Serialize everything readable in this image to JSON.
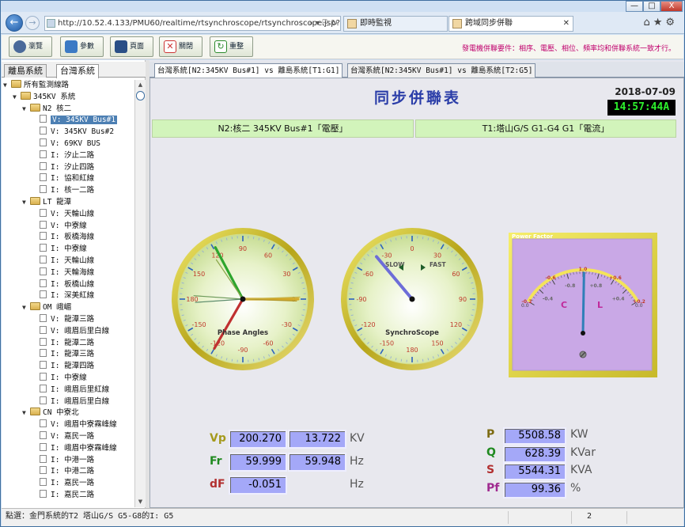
{
  "browser": {
    "url": "http://10.52.4.133/PMU60/realtime/rtsynchroscope/rtsynchroscope.jsp?fun=null",
    "addr_icons": "⌕ ▾ ⎘ ↻",
    "tabs": [
      {
        "label": "即時監視"
      },
      {
        "label": "跨域同步併聯"
      }
    ],
    "window_buttons": {
      "minimize": "—",
      "maximize": "□",
      "close": "X"
    },
    "right_icons": "⌂★⚙"
  },
  "toolbar": {
    "buttons": [
      {
        "label": "瀏覽"
      },
      {
        "label": "參數"
      },
      {
        "label": "頁面"
      },
      {
        "label": "關閉"
      },
      {
        "label": "重整"
      }
    ],
    "tip": "發電機併聯要件：相序、電壓、相位、頻率均和併聯系統一致才行。"
  },
  "sidebar": {
    "tabs": [
      "離島系統",
      "台灣系統"
    ],
    "tree": [
      {
        "label": "所有監測線路",
        "level": 0,
        "type": "folder"
      },
      {
        "label": "345KV 系統",
        "level": 1,
        "type": "folder"
      },
      {
        "label": "N2 核二",
        "level": 2,
        "type": "folder"
      },
      {
        "label": "V: 345KV Bus#1",
        "level": 3,
        "type": "doc",
        "selected": true
      },
      {
        "label": "V: 345KV Bus#2",
        "level": 3,
        "type": "doc"
      },
      {
        "label": "V: 69KV BUS",
        "level": 3,
        "type": "doc"
      },
      {
        "label": "I: 汐止二路",
        "level": 3,
        "type": "doc"
      },
      {
        "label": "I: 汐止四路",
        "level": 3,
        "type": "doc"
      },
      {
        "label": "I: 協和紅線",
        "level": 3,
        "type": "doc"
      },
      {
        "label": "I: 核一二路",
        "level": 3,
        "type": "doc"
      },
      {
        "label": "LT 龍潭",
        "level": 2,
        "type": "folder"
      },
      {
        "label": "V: 天輪山線",
        "level": 3,
        "type": "doc"
      },
      {
        "label": "V: 中寮線",
        "level": 3,
        "type": "doc"
      },
      {
        "label": "I: 板橋海線",
        "level": 3,
        "type": "doc"
      },
      {
        "label": "I: 中寮線",
        "level": 3,
        "type": "doc"
      },
      {
        "label": "I: 天輪山線",
        "level": 3,
        "type": "doc"
      },
      {
        "label": "I: 天輪海線",
        "level": 3,
        "type": "doc"
      },
      {
        "label": "I: 板橋山線",
        "level": 3,
        "type": "doc"
      },
      {
        "label": "I: 深美紅線",
        "level": 3,
        "type": "doc"
      },
      {
        "label": "OM 峨嵋",
        "level": 2,
        "type": "folder"
      },
      {
        "label": "V: 龍潭三路",
        "level": 3,
        "type": "doc"
      },
      {
        "label": "V: 峨眉后里白線",
        "level": 3,
        "type": "doc"
      },
      {
        "label": "I: 龍潭二路",
        "level": 3,
        "type": "doc"
      },
      {
        "label": "I: 龍潭三路",
        "level": 3,
        "type": "doc"
      },
      {
        "label": "I: 龍潭四路",
        "level": 3,
        "type": "doc"
      },
      {
        "label": "I: 中寮線",
        "level": 3,
        "type": "doc"
      },
      {
        "label": "I: 峨眉后里紅線",
        "level": 3,
        "type": "doc"
      },
      {
        "label": "I: 峨眉后里白線",
        "level": 3,
        "type": "doc"
      },
      {
        "label": "CN 中寮北",
        "level": 2,
        "type": "folder"
      },
      {
        "label": "V: 峨眉中寮霧峰線",
        "level": 3,
        "type": "doc"
      },
      {
        "label": "V: 嘉民一路",
        "level": 3,
        "type": "doc"
      },
      {
        "label": "I: 峨眉中寮霧峰線",
        "level": 3,
        "type": "doc"
      },
      {
        "label": "I: 中港一路",
        "level": 3,
        "type": "doc"
      },
      {
        "label": "I: 中港二路",
        "level": 3,
        "type": "doc"
      },
      {
        "label": "I: 嘉民一路",
        "level": 3,
        "type": "doc"
      },
      {
        "label": "I: 嘉民二路",
        "level": 3,
        "type": "doc"
      }
    ]
  },
  "main": {
    "tabs": [
      "台灣系統[N2:345KV Bus#1] vs 離島系統[T1:G1]",
      "台灣系統[N2:345KV Bus#1] vs 離島系統[T2:G5]"
    ],
    "title": "同步併聯表",
    "date": "2018-07-09",
    "time": "14:57:44A",
    "left_channel": "N2:核二 345KV Bus#1「電壓」",
    "right_channel": "T1:塔山G/S G1-G4 G1「電流」"
  },
  "gauges": {
    "phase": {
      "label": "Phase Angles",
      "ticks": [
        "0",
        "30",
        "60",
        "90",
        "120",
        "150",
        "180",
        "-150",
        "-120",
        "-90",
        "-60",
        "-30"
      ],
      "needles_deg": [
        0,
        -2,
        2,
        118,
        124,
        240,
        176,
        184
      ]
    },
    "synchro": {
      "label": "SynchroScope",
      "slow": "SLOW",
      "fast": "FAST",
      "ticks": [
        "0",
        "-30",
        "-60",
        "-90",
        "-120",
        "-150",
        "180",
        "150",
        "120",
        "90",
        "60",
        "30"
      ],
      "needle_deg": -40
    },
    "pf": {
      "title": "Power Factor",
      "scale": [
        "-0.2",
        "-0.4",
        "-0.6",
        "-0.8",
        "1.0",
        "+0.8",
        "+0.6",
        "+0.4",
        "+0.2"
      ],
      "ends": [
        "0.0",
        "0.0"
      ],
      "c": "C",
      "l": "L",
      "value": 0.993
    }
  },
  "readings": {
    "left": [
      {
        "label": "Vp",
        "v1": "200.270",
        "v2": "13.722",
        "unit": "KV"
      },
      {
        "label": "Fr",
        "v1": "59.999",
        "v2": "59.948",
        "unit": "Hz"
      },
      {
        "label": "dF",
        "v1": "-0.051",
        "v2": "",
        "unit": "Hz"
      }
    ],
    "right": [
      {
        "label": "P",
        "value": "5508.58",
        "unit": "KW"
      },
      {
        "label": "Q",
        "value": "628.39",
        "unit": "KVar"
      },
      {
        "label": "S",
        "value": "5544.31",
        "unit": "KVA"
      },
      {
        "label": "Pf",
        "value": "99.36",
        "unit": "%"
      }
    ]
  },
  "status": {
    "text": "點選：金門系統的T2 塔山G/S G5-G8的I: G5",
    "page": "2"
  },
  "colors": {
    "vp": "#a59a1d",
    "fr": "#208a20",
    "df": "#b23030",
    "p": "#7c6a10",
    "q": "#208a20",
    "s": "#b23030",
    "pf": "#a02a90"
  }
}
